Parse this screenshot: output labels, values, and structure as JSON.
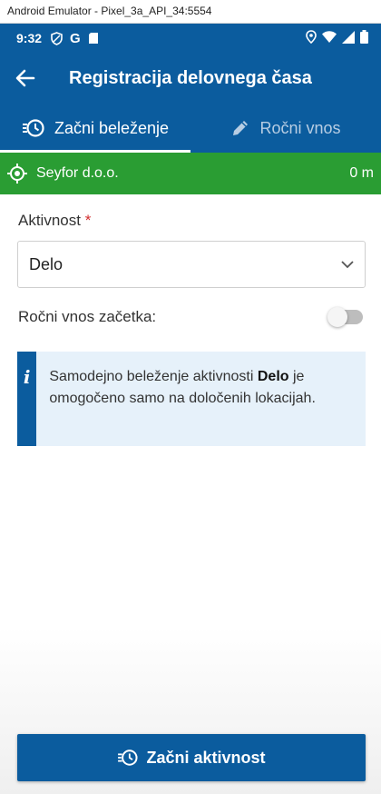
{
  "emulator": {
    "title": "Android Emulator - Pixel_3a_API_34:5554"
  },
  "status_bar": {
    "time": "9:32",
    "left_icons": [
      "shield-icon",
      "google-icon",
      "sd-card-icon"
    ],
    "right_icons": [
      "location-icon",
      "wifi-icon",
      "signal-icon",
      "battery-icon"
    ]
  },
  "app_bar": {
    "title": "Registracija delovnega časa",
    "back_icon": "arrow-left-icon"
  },
  "tabs": [
    {
      "label": "Začni beleženje",
      "icon": "timer-icon",
      "active": true
    },
    {
      "label": "Ročni vnos",
      "icon": "pencil-icon",
      "active": false
    }
  ],
  "location": {
    "name": "Seyfor d.o.o.",
    "distance": "0 m",
    "icon": "gps-target-icon",
    "color": "#2a9d33"
  },
  "activity": {
    "label": "Aktivnost",
    "required_mark": "*",
    "value": "Delo"
  },
  "manual_start": {
    "label": "Ročni vnos začetka:",
    "enabled": false
  },
  "info": {
    "icon_glyph": "i",
    "text_before": "Samodejno beleženje aktivnosti ",
    "text_bold": "Delo",
    "text_after": " je omogočeno samo na določenih lokacijah."
  },
  "primary_button": {
    "label": "Začni aktivnost",
    "icon": "timer-icon"
  },
  "colors": {
    "primary": "#0b5c9e",
    "accent_green": "#2a9d33",
    "info_bg": "#e6f1fa",
    "required": "#d32f2f"
  }
}
